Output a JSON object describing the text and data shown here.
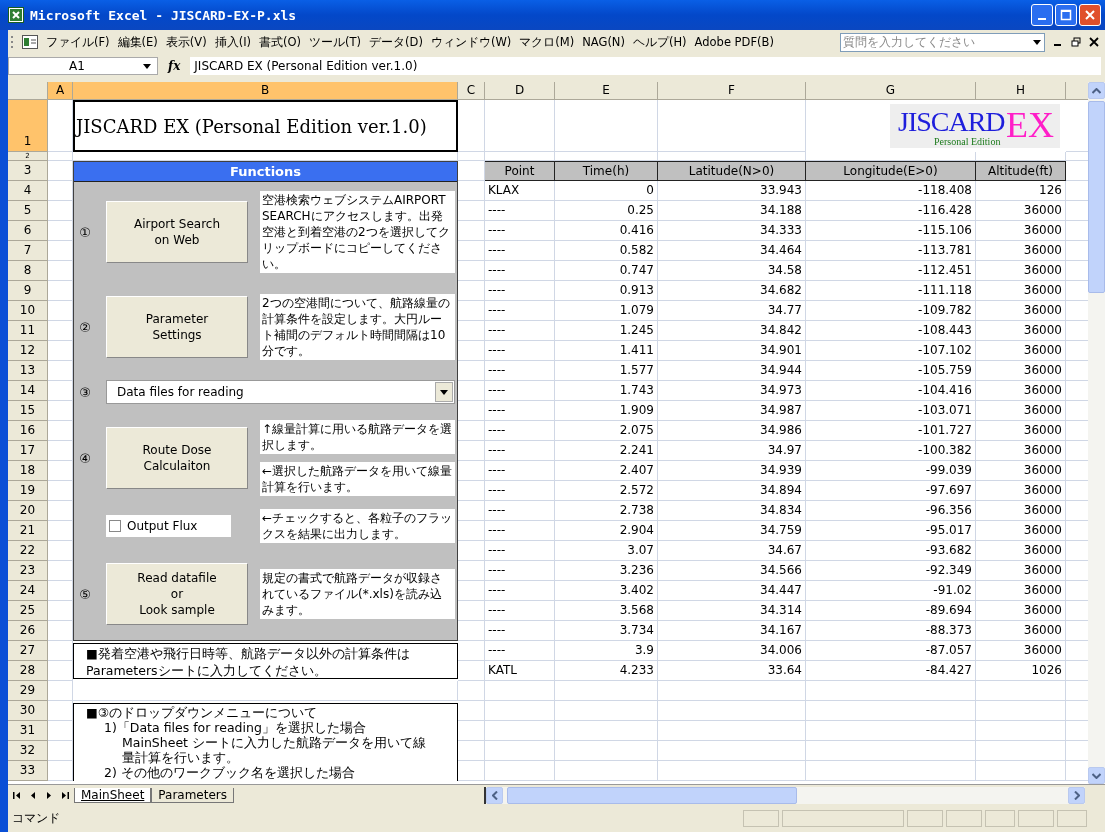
{
  "window": {
    "title": "Microsoft Excel - JISCARD-EX-P.xls"
  },
  "menu": [
    "ファイル(F)",
    "編集(E)",
    "表示(V)",
    "挿入(I)",
    "書式(O)",
    "ツール(T)",
    "データ(D)",
    "ウィンドウ(W)",
    "マクロ(M)",
    "NAG(N)",
    "ヘルプ(H)",
    "Adobe PDF(B)"
  ],
  "help_search": {
    "placeholder": "質問を入力してください"
  },
  "formula_bar": {
    "name_box": "A1",
    "function_label": "fx",
    "value": "JISCARD EX (Personal Edition ver.1.0)"
  },
  "columns": [
    {
      "label": "A",
      "selected": true
    },
    {
      "label": "B",
      "selected": true
    },
    {
      "label": "C",
      "selected": false
    },
    {
      "label": "D",
      "selected": false
    },
    {
      "label": "E",
      "selected": false
    },
    {
      "label": "F",
      "selected": false
    },
    {
      "label": "G",
      "selected": false
    },
    {
      "label": "H",
      "selected": false
    }
  ],
  "row_headers": [
    {
      "label": "1",
      "selected": true
    },
    {
      "label": "2",
      "selected": false
    },
    {
      "label": "3",
      "selected": false
    },
    {
      "label": "4",
      "selected": false
    },
    {
      "label": "5",
      "selected": false
    },
    {
      "label": "6",
      "selected": false
    },
    {
      "label": "7",
      "selected": false
    },
    {
      "label": "8",
      "selected": false
    },
    {
      "label": "9",
      "selected": false
    },
    {
      "label": "10",
      "selected": false
    },
    {
      "label": "11",
      "selected": false
    },
    {
      "label": "12",
      "selected": false
    },
    {
      "label": "13",
      "selected": false
    },
    {
      "label": "14",
      "selected": false
    },
    {
      "label": "15",
      "selected": false
    },
    {
      "label": "16",
      "selected": false
    },
    {
      "label": "17",
      "selected": false
    },
    {
      "label": "18",
      "selected": false
    },
    {
      "label": "19",
      "selected": false
    },
    {
      "label": "20",
      "selected": false
    },
    {
      "label": "21",
      "selected": false
    },
    {
      "label": "22",
      "selected": false
    },
    {
      "label": "23",
      "selected": false
    },
    {
      "label": "24",
      "selected": false
    },
    {
      "label": "25",
      "selected": false
    },
    {
      "label": "26",
      "selected": false
    },
    {
      "label": "27",
      "selected": false
    },
    {
      "label": "28",
      "selected": false
    },
    {
      "label": "29",
      "selected": false
    },
    {
      "label": "30",
      "selected": false
    },
    {
      "label": "31",
      "selected": false
    },
    {
      "label": "32",
      "selected": false
    },
    {
      "label": "33",
      "selected": false
    }
  ],
  "title_cell": "JISCARD EX (Personal Edition ver.1.0)",
  "logo": {
    "main": "JISCARD",
    "accent": "EX",
    "sub": "Personal Edition"
  },
  "functions": {
    "title": "Functions",
    "items": [
      {
        "kind": "button",
        "number": "①",
        "label": "Airport Search\non Web",
        "notes": [
          "空港検索ウェブシステムAIRPORT SEARCHにアクセスします。出発空港と到着空港の2つを選択してクリップボードにコピーしてください。"
        ]
      },
      {
        "kind": "button",
        "number": "②",
        "label": "Parameter\nSettings",
        "notes": [
          "2つの空港間について、航路線量の計算条件を設定します。大円ルート補間のデフォルト時間間隔は10分です。"
        ]
      },
      {
        "kind": "dropdown",
        "number": "③",
        "value": "Data files for reading"
      },
      {
        "kind": "button",
        "number": "④",
        "label": "Route Dose\nCalculaiton",
        "notes": [
          "↑線量計算に用いる航路データを選択します。",
          "←選択した航路データを用いて線量計算を行います。"
        ]
      },
      {
        "kind": "checkbox",
        "label": "Output Flux",
        "checked": false,
        "notes": [
          "←チェックすると、各粒子のフラックスを結果に出力します。"
        ]
      },
      {
        "kind": "button",
        "number": "⑤",
        "label": "Read datafile\nor\nLook sample",
        "notes": [
          "規定の書式で航路データが収録されているファイル(*.xls)を読み込みます。"
        ]
      }
    ]
  },
  "note_1": "■発着空港や飛行日時等、航路データ以外の計算条件はParametersシートに入力してください。",
  "note_2": {
    "text": "■③のドロップダウンメニューについて",
    "children": [
      {
        "text": "1)「Data files for reading」を選択した場合",
        "children": [
          {
            "text": "MainSheet シートに入力した航路データを用いて線量計算を行います。"
          }
        ]
      },
      {
        "text": "2) その他のワークブック名を選択した場合"
      }
    ]
  },
  "table": {
    "columns": [
      "Point",
      "Time(h)",
      "Latitude(N>0)",
      "Longitude(E>0)",
      "Altitude(ft)"
    ],
    "rows": [
      [
        "KLAX",
        "0",
        "33.943",
        "-118.408",
        "126"
      ],
      [
        "----",
        "0.25",
        "34.188",
        "-116.428",
        "36000"
      ],
      [
        "----",
        "0.416",
        "34.333",
        "-115.106",
        "36000"
      ],
      [
        "----",
        "0.582",
        "34.464",
        "-113.781",
        "36000"
      ],
      [
        "----",
        "0.747",
        "34.58",
        "-112.451",
        "36000"
      ],
      [
        "----",
        "0.913",
        "34.682",
        "-111.118",
        "36000"
      ],
      [
        "----",
        "1.079",
        "34.77",
        "-109.782",
        "36000"
      ],
      [
        "----",
        "1.245",
        "34.842",
        "-108.443",
        "36000"
      ],
      [
        "----",
        "1.411",
        "34.901",
        "-107.102",
        "36000"
      ],
      [
        "----",
        "1.577",
        "34.944",
        "-105.759",
        "36000"
      ],
      [
        "----",
        "1.743",
        "34.973",
        "-104.416",
        "36000"
      ],
      [
        "----",
        "1.909",
        "34.987",
        "-103.071",
        "36000"
      ],
      [
        "----",
        "2.075",
        "34.986",
        "-101.727",
        "36000"
      ],
      [
        "----",
        "2.241",
        "34.97",
        "-100.382",
        "36000"
      ],
      [
        "----",
        "2.407",
        "34.939",
        "-99.039",
        "36000"
      ],
      [
        "----",
        "2.572",
        "34.894",
        "-97.697",
        "36000"
      ],
      [
        "----",
        "2.738",
        "34.834",
        "-96.356",
        "36000"
      ],
      [
        "----",
        "2.904",
        "34.759",
        "-95.017",
        "36000"
      ],
      [
        "----",
        "3.07",
        "34.67",
        "-93.682",
        "36000"
      ],
      [
        "----",
        "3.236",
        "34.566",
        "-92.349",
        "36000"
      ],
      [
        "----",
        "3.402",
        "34.447",
        "-91.02",
        "36000"
      ],
      [
        "----",
        "3.568",
        "34.314",
        "-89.694",
        "36000"
      ],
      [
        "----",
        "3.734",
        "34.167",
        "-88.373",
        "36000"
      ],
      [
        "----",
        "3.9",
        "34.006",
        "-87.057",
        "36000"
      ],
      [
        "KATL",
        "4.233",
        "33.64",
        "-84.427",
        "1026"
      ]
    ]
  },
  "sheet_tabs": [
    {
      "label": "MainSheet",
      "selected": true
    },
    {
      "label": "Parameters",
      "selected": false
    }
  ],
  "status_bar": "コマンド"
}
